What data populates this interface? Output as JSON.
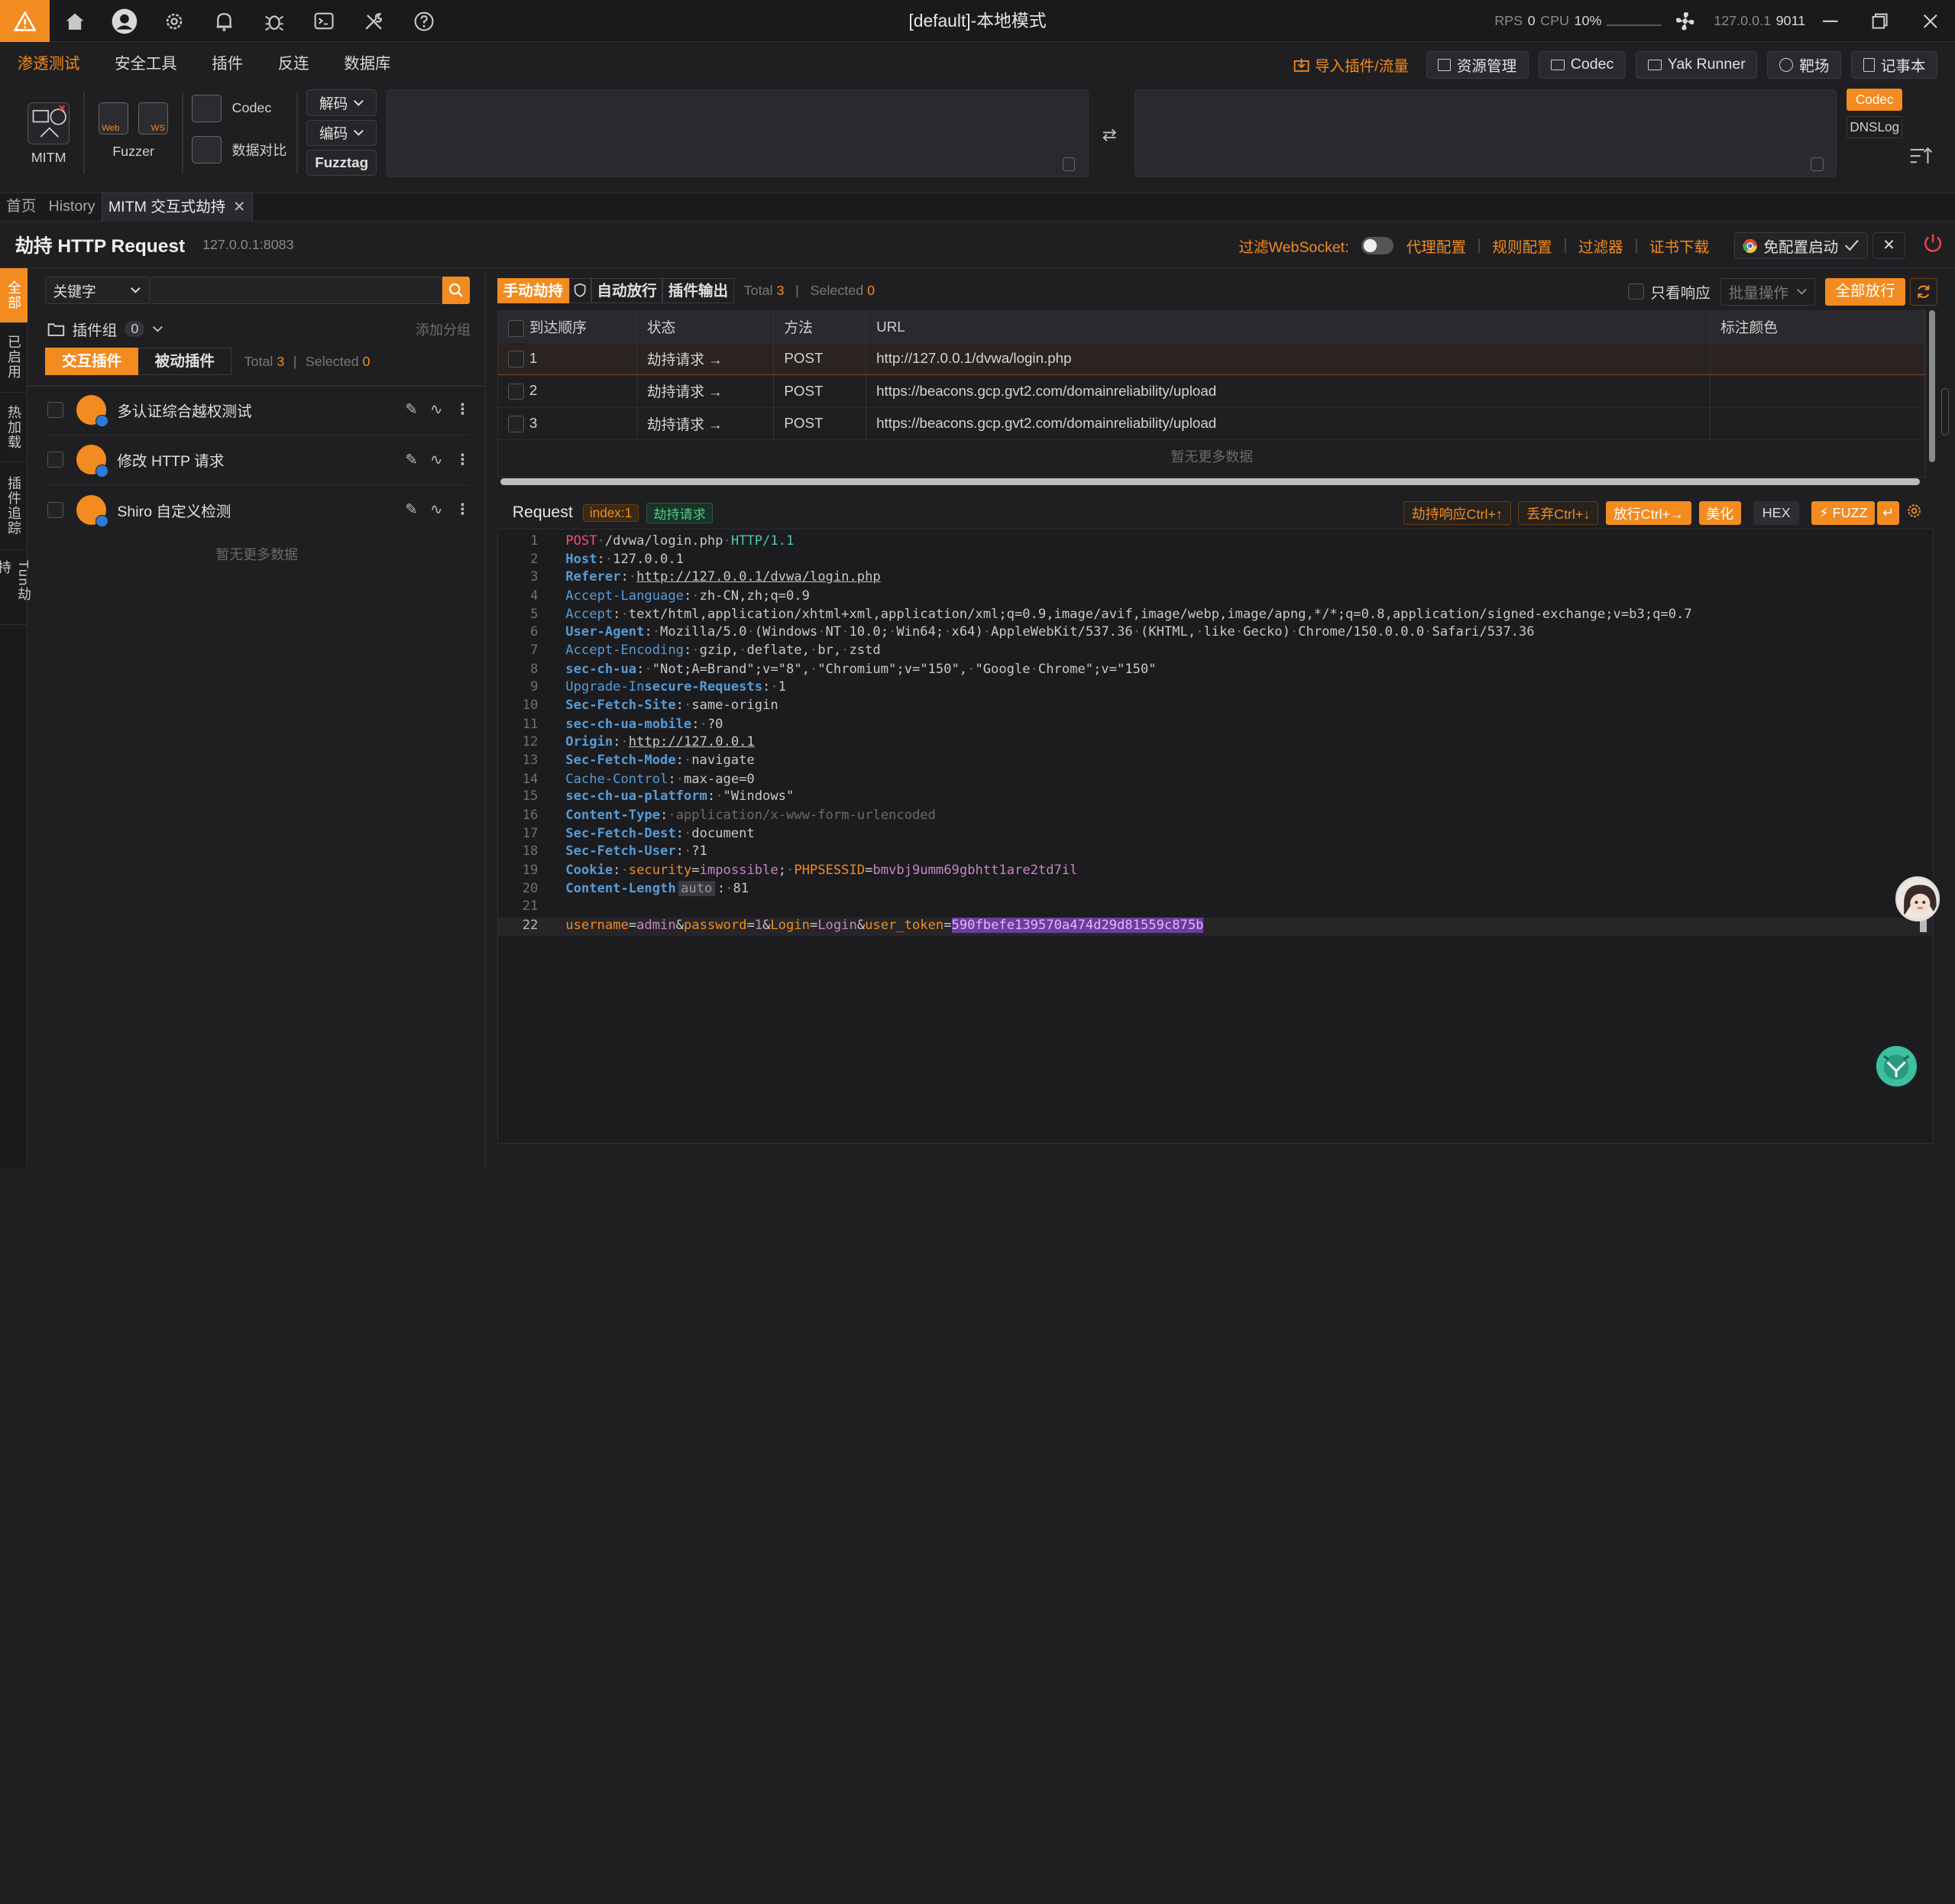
{
  "window": {
    "title": "[default]-本地模式",
    "rps_label": "RPS",
    "rps_value": "0",
    "cpu_label": "CPU",
    "cpu_value": "10%",
    "host": "127.0.0.1",
    "port": "9011"
  },
  "menu": {
    "items": [
      "渗透测试",
      "安全工具",
      "插件",
      "反连",
      "数据库"
    ],
    "import_link": "导入插件/流量",
    "buttons": [
      "资源管理",
      "Codec",
      "Yak Runner",
      "靶场",
      "记事本"
    ]
  },
  "ribbon": {
    "mitm": "MITM",
    "fuzzer": "Fuzzer",
    "fuzzer_web": "Web",
    "fuzzer_ws": "WS",
    "codec": "Codec",
    "compare": "数据对比",
    "decode": "解码",
    "encode": "编码",
    "fuzztag": "Fuzztag",
    "side_codec": "Codec",
    "side_dnslog": "DNSLog"
  },
  "tabs": {
    "home": "首页",
    "history": "History",
    "mitm": "MITM 交互式劫持"
  },
  "header": {
    "title": "劫持 HTTP Request",
    "address": "127.0.0.1:8083",
    "filter_ws": "过滤WebSocket:",
    "proxy_cfg": "代理配置",
    "rule_cfg": "规则配置",
    "filter": "过滤器",
    "cert": "证书下载",
    "launch": "免配置启动"
  },
  "vtabs": [
    "全部",
    "已启用",
    "热加载",
    "插件追踪",
    "Tun劫持"
  ],
  "plugins": {
    "search_type": "关键字",
    "group_label": "插件组",
    "group_count": "0",
    "add_group": "添加分组",
    "seg_interactive": "交互插件",
    "seg_passive": "被动插件",
    "total_label": "Total",
    "total": "3",
    "selected_label": "Selected",
    "selected": "0",
    "items": [
      {
        "name": "多认证综合越权测试"
      },
      {
        "name": "修改 HTTP 请求"
      },
      {
        "name": "Shiro 自定义检测"
      }
    ],
    "no_more": "暂无更多数据"
  },
  "main": {
    "toggle_manual": "手动劫持",
    "toggle_auto": "自动放行",
    "toggle_output": "插件输出",
    "total_label": "Total",
    "total": "3",
    "selected_label": "Selected",
    "selected": "0",
    "only_response": "只看响应",
    "batch": "批量操作",
    "release_all": "全部放行",
    "columns": [
      "到达顺序",
      "状态",
      "方法",
      "URL",
      "标注颜色"
    ],
    "rows": [
      {
        "order": "1",
        "status": "劫持请求 →",
        "method": "POST",
        "url": "http://127.0.0.1/dvwa/login.php"
      },
      {
        "order": "2",
        "status": "劫持请求 →",
        "method": "POST",
        "url": "https://beacons.gcp.gvt2.com/domainreliability/upload"
      },
      {
        "order": "3",
        "status": "劫持请求 →",
        "method": "POST",
        "url": "https://beacons.gcp.gvt2.com/domainreliability/upload"
      }
    ],
    "no_more": "暂无更多数据"
  },
  "request": {
    "label": "Request",
    "index_tag": "index:1",
    "state_tag": "劫持请求",
    "hijack_resp": "劫持响应Ctrl+↑",
    "drop": "丢弃Ctrl+↓",
    "release": "放行Ctrl+→",
    "beautify": "美化",
    "hex": "HEX",
    "fuzz": "FUZZ",
    "auto_tag": "auto"
  },
  "colors": {
    "accent": "#f28b20",
    "bg": "#1f1f22"
  }
}
